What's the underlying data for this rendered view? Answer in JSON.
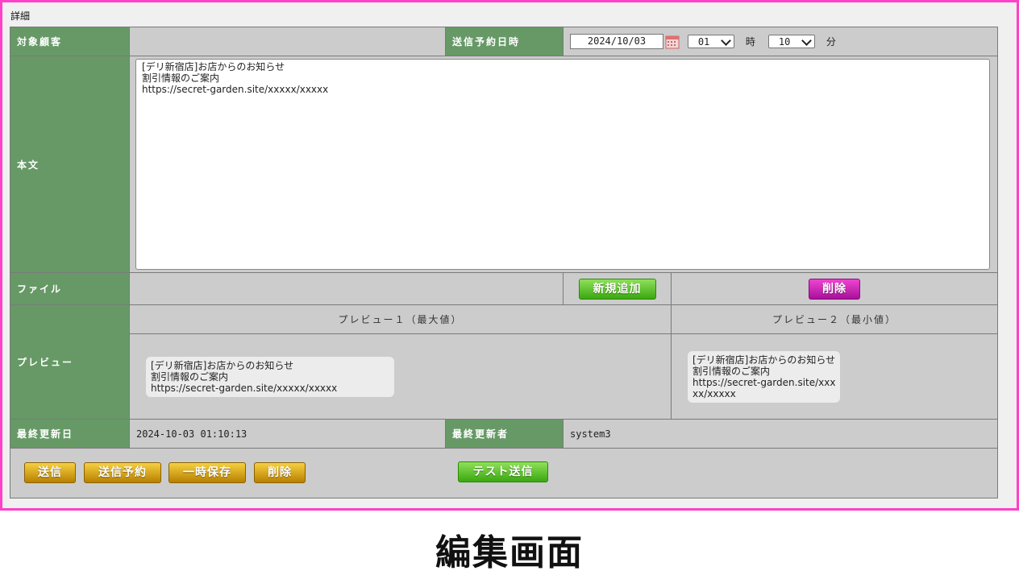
{
  "section_title": "詳細",
  "labels": {
    "target_customer": "対象顧客",
    "scheduled_datetime": "送信予約日時",
    "body": "本文",
    "file": "ファイル",
    "preview": "プレビュー",
    "last_updated": "最終更新日",
    "last_updater": "最終更新者"
  },
  "schedule": {
    "date": "2024/10/03",
    "hour": "01",
    "hour_unit": "時",
    "minute": "10",
    "minute_unit": "分"
  },
  "message_body": "[デリ新宿店]お店からのお知らせ\n割引情報のご案内\nhttps://secret-garden.site/xxxxx/xxxxx",
  "file_buttons": {
    "add": "新規追加",
    "delete": "削除"
  },
  "preview": {
    "max_header": "プレビュー１（最大値）",
    "min_header": "プレビュー２（最小値）",
    "max_text": "[デリ新宿店]お店からのお知らせ\n割引情報のご案内\nhttps://secret-garden.site/xxxxx/xxxxx",
    "min_text": "[デリ新宿店]お店からのお知らせ\n割引情報のご案内\nhttps://secret-garden.site/xxx\nxx/xxxxx"
  },
  "last_updated_value": "2024-10-03 01:10:13",
  "last_updater_value": "system3",
  "actions": {
    "send": "送信",
    "schedule_send": "送信予約",
    "temp_save": "一時保存",
    "delete": "削除",
    "test_send": "テスト送信"
  },
  "caption": "編集画面",
  "colors": {
    "frame": "#ff40c8",
    "label_bg": "#669966",
    "value_bg": "#cccccc",
    "btn_green": "#3aa80f",
    "btn_magenta": "#a8109a",
    "btn_gold": "#b88000"
  }
}
